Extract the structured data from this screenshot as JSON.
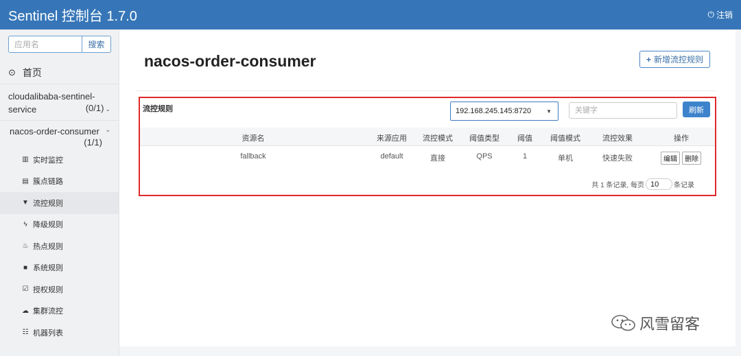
{
  "header": {
    "title": "Sentinel 控制台 1.7.0",
    "logout_label": "注销",
    "logout_icon": "sign-out-icon",
    "background": "#3676b8"
  },
  "sidebar": {
    "search_placeholder": "应用名",
    "search_button": "搜索",
    "home_label": "首页",
    "apps": [
      {
        "name": "cloudalibaba-sentinel-service",
        "count": "(0/1)"
      },
      {
        "name": "nacos-order-consumer",
        "count": "(1/1)"
      }
    ],
    "menu": [
      {
        "label": "实时监控",
        "icon": "bar-chart-icon"
      },
      {
        "label": "簇点链路",
        "icon": "list-icon"
      },
      {
        "label": "流控规则",
        "icon": "filter-icon",
        "active": true
      },
      {
        "label": "降级规则",
        "icon": "flash-icon"
      },
      {
        "label": "热点规则",
        "icon": "fire-icon"
      },
      {
        "label": "系统规则",
        "icon": "lock-icon"
      },
      {
        "label": "授权规则",
        "icon": "check-icon"
      },
      {
        "label": "集群流控",
        "icon": "cloud-icon"
      },
      {
        "label": "机器列表",
        "icon": "th-list-icon"
      }
    ]
  },
  "main": {
    "page_title": "nacos-order-consumer",
    "add_rule_button": "新增流控规则",
    "panel": {
      "title": "流控规则",
      "machine_selected": "192.168.245.145:8720",
      "keyword_placeholder": "关键字",
      "refresh_button": "刷新",
      "columns": [
        "资源名",
        "来源应用",
        "流控模式",
        "阈值类型",
        "阈值",
        "阈值模式",
        "流控效果",
        "操作"
      ],
      "rows": [
        {
          "resource": "fallback",
          "origin": "default",
          "mode": "直接",
          "threshold_type": "QPS",
          "threshold": "1",
          "cluster_mode": "单机",
          "effect": "快速失败",
          "edit": "编辑",
          "delete": "删除"
        }
      ],
      "pager": {
        "prefix": "共 1 条记录, 每页",
        "page_size": "10",
        "suffix": "条记录"
      }
    }
  },
  "watermark": {
    "text": "风雪留客"
  },
  "colors": {
    "accent": "#3676b8",
    "highlight_border": "#e0282a",
    "refresh": "#3d83cc"
  }
}
